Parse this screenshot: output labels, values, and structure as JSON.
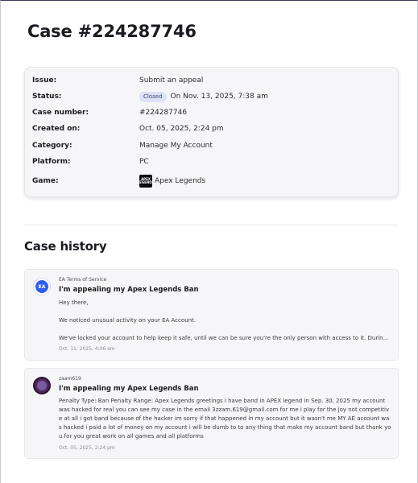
{
  "page": {
    "title": "Case #224287746"
  },
  "details": {
    "issue_label": "Issue:",
    "issue_value": "Submit an appeal",
    "status_label": "Status:",
    "status_badge": "Closed",
    "status_date": "On Nov. 13, 2025, 7:38 am",
    "case_number_label": "Case number:",
    "case_number_value": "#224287746",
    "created_label": "Created on:",
    "created_value": "Oct. 05, 2025, 2:24 pm",
    "category_label": "Category:",
    "category_value": "Manage My Account",
    "platform_label": "Platform:",
    "platform_value": "PC",
    "game_label": "Game:",
    "game_logo_text": "APEX LEGENDS",
    "game_value": "Apex Legends"
  },
  "history": {
    "title": "Case history",
    "messages": [
      {
        "author": "EA Terms of Service",
        "avatar_text": "EA",
        "subject": "I'm appealing my Apex Legends Ban",
        "line1": "Hey there,",
        "line2": "We noticed unusual activity on your EA Account.",
        "line3": "We've locked your account to help keep it safe, until we can be sure you're the only person with access to it. During this time",
        "timestamp": "Oct. 11, 2025, 4:06 am"
      },
      {
        "author": "zaam619",
        "subject": "I'm appealing my Apex Legends Ban",
        "body": "Penalty Type: Ban Penalty Range: Apex Legends greetings i have band in APEX legend in  Sep. 30, 2025 my account was hacked for real you can see my case in the email 3zzam.619@gmail.com for me i play for the joy not competitive at all i got band because of the hacker im sorry if that happened in my account but it wasn't me MY AE account was hacked i paid a lot of money on my account i will be dumb to to any thing that make my account band but thank you for you great work on all games and all platforms",
        "timestamp": "Oct. 05, 2025, 2:24 pm"
      }
    ]
  },
  "colors": {
    "badge_bg": "#dde2f8",
    "ea_blue": "#2d5ff0",
    "card_bg": "#f6f6f8"
  }
}
